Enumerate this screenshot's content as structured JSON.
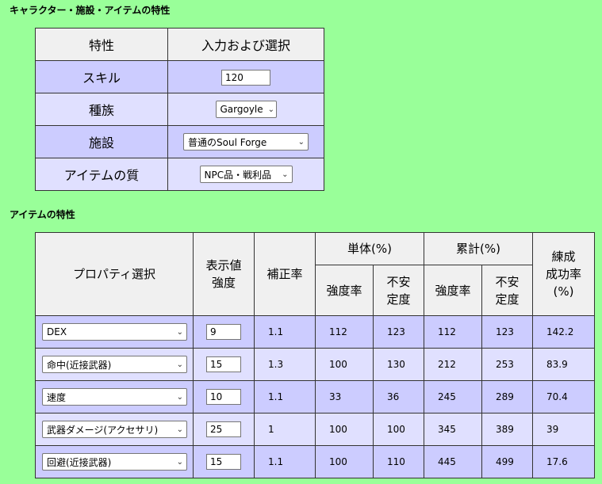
{
  "section1": {
    "title": "キャラクター・施設・アイテムの特性"
  },
  "char_table": {
    "header": {
      "col1": "特性",
      "col2": "入力および選択"
    },
    "rows": [
      {
        "label": "スキル",
        "control": "input",
        "value": "120"
      },
      {
        "label": "種族",
        "control": "select",
        "value": "Gargoyle"
      },
      {
        "label": "施設",
        "control": "select",
        "value": "普通のSoul Forge"
      },
      {
        "label": "アイテムの質",
        "control": "select",
        "value": "NPC品・戦利品"
      }
    ]
  },
  "section2": {
    "title": "アイテムの特性"
  },
  "prop_table": {
    "headers": {
      "property": "プロパティ選択",
      "display_line1": "表示値",
      "display_line2": "強度",
      "correction": "補正率",
      "single": "単体(%)",
      "cumulative": "累計(%)",
      "success_line1": "練成",
      "success_line2": "成功率",
      "success_line3": "(%)",
      "intensity": "強度率",
      "instability_line1": "不安",
      "instability_line2": "定度"
    },
    "rows": [
      {
        "property": "DEX",
        "value": "9",
        "correction": "1.1",
        "single_intensity": "112",
        "single_instability": "123",
        "cum_intensity": "112",
        "cum_instability": "123",
        "success": "142.2"
      },
      {
        "property": "命中(近接武器)",
        "value": "15",
        "correction": "1.3",
        "single_intensity": "100",
        "single_instability": "130",
        "cum_intensity": "212",
        "cum_instability": "253",
        "success": "83.9"
      },
      {
        "property": "速度",
        "value": "10",
        "correction": "1.1",
        "single_intensity": "33",
        "single_instability": "36",
        "cum_intensity": "245",
        "cum_instability": "289",
        "success": "70.4"
      },
      {
        "property": "武器ダメージ(アクセサリ)",
        "value": "25",
        "correction": "1",
        "single_intensity": "100",
        "single_instability": "100",
        "cum_intensity": "345",
        "cum_instability": "389",
        "success": "39"
      },
      {
        "property": "回避(近接武器)",
        "value": "15",
        "correction": "1.1",
        "single_intensity": "100",
        "single_instability": "110",
        "cum_intensity": "445",
        "cum_instability": "499",
        "success": "17.6"
      }
    ]
  }
}
